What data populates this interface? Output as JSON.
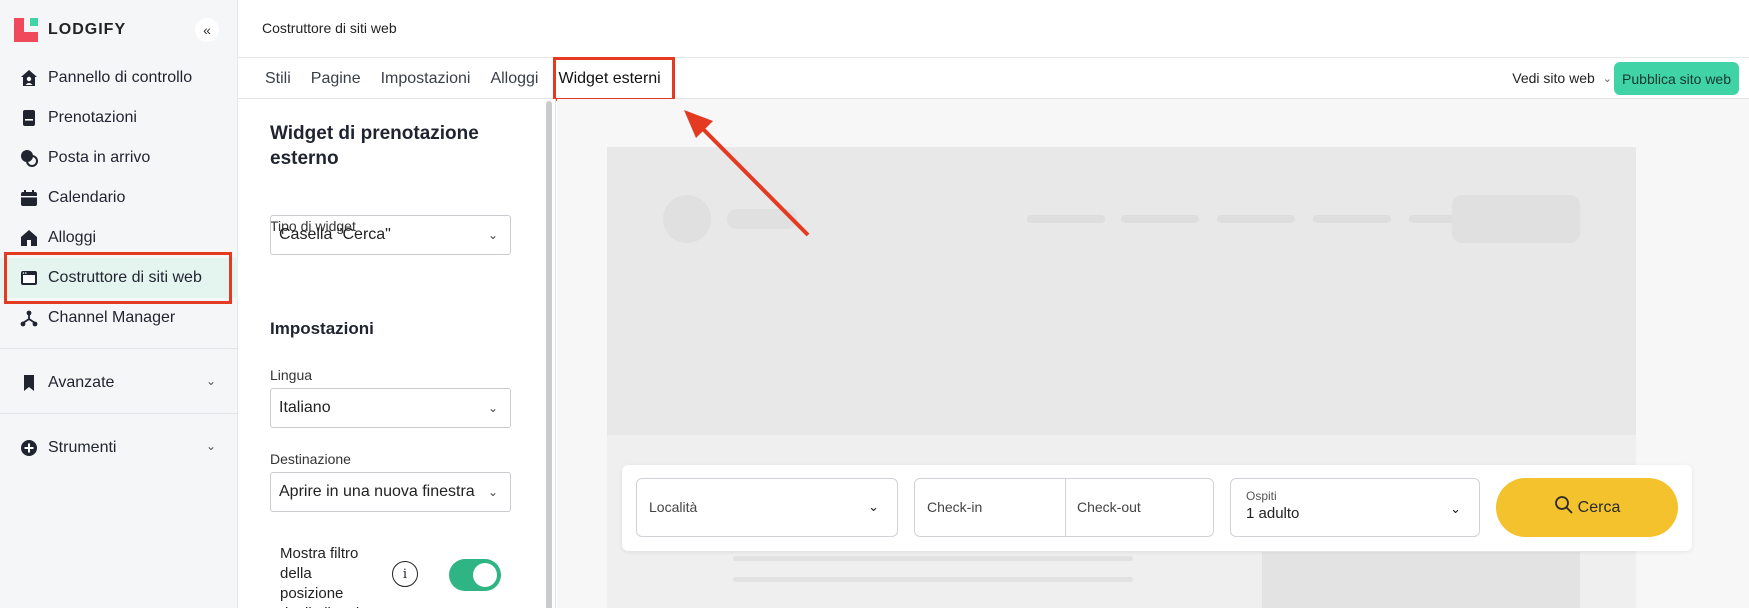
{
  "app": {
    "logo_text": "LODGIFY",
    "collapse_glyph": "«"
  },
  "sidebar": {
    "items": [
      {
        "label": "Pannello di controllo",
        "icon": "home-user-icon"
      },
      {
        "label": "Prenotazioni",
        "icon": "booking-icon"
      },
      {
        "label": "Posta in arrivo",
        "icon": "chat-icon"
      },
      {
        "label": "Calendario",
        "icon": "calendar-icon"
      },
      {
        "label": "Alloggi",
        "icon": "house-icon"
      },
      {
        "label": "Costruttore di siti web",
        "icon": "browser-icon",
        "active": true
      },
      {
        "label": "Channel Manager",
        "icon": "network-icon"
      }
    ],
    "sections": [
      {
        "label": "Avanzate",
        "icon": "bookmark-icon"
      },
      {
        "label": "Strumenti",
        "icon": "plus-circle-icon"
      }
    ]
  },
  "header": {
    "title": "Costruttore di siti web"
  },
  "tabs": [
    {
      "label": "Stili"
    },
    {
      "label": "Pagine"
    },
    {
      "label": "Impostazioni"
    },
    {
      "label": "Alloggi"
    },
    {
      "label": "Widget esterni",
      "active": true
    }
  ],
  "toolbar": {
    "view_site_label": "Vedi sito web",
    "publish_label": "Pubblica sito web"
  },
  "panel": {
    "title": "Widget di prenotazione esterno",
    "widget_type_label": "Tipo di widget",
    "widget_type_value": "Casella \"Cerca\"",
    "settings_heading": "Impostazioni",
    "language_label": "Lingua",
    "language_value": "Italiano",
    "destination_label": "Destinazione",
    "destination_value": "Aprire in una nuova finestra",
    "filter_toggle_label": "Mostra filtro della posizione degli alloggi",
    "filter_toggle_on": true
  },
  "preview_widget": {
    "location_label": "Località",
    "checkin_label": "Check-in",
    "checkout_label": "Check-out",
    "guests_label": "Ospiti",
    "guests_value": "1 adulto",
    "search_label": "Cerca"
  },
  "colors": {
    "accent_green": "#3fd3a5",
    "toggle_green": "#2fb483",
    "search_yellow": "#f3c22d",
    "annotation_red": "#e53a22",
    "brand_red": "#f0495b"
  }
}
